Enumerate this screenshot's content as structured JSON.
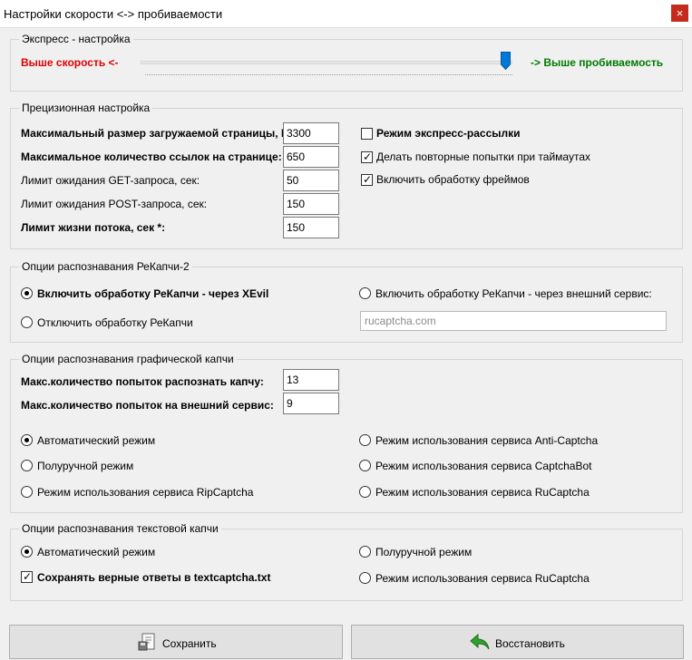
{
  "window": {
    "title": "Настройки скорости <-> пробиваемости",
    "close_glyph": "×"
  },
  "express": {
    "legend": "Экспресс - настройка",
    "left_label": "Выше скорость <-",
    "right_label": "-> Выше пробиваемость",
    "left_color": "#e00000",
    "right_color": "#007a00",
    "slider_level": 0.98
  },
  "precision": {
    "legend": "Прецизионная настройка",
    "fields": [
      {
        "label": "Максимальный размер загружаемой страницы, Кб:",
        "value": "3300"
      },
      {
        "label": "Максимальное количество ссылок на странице:",
        "value": "650"
      },
      {
        "label": "Лимит ожидания GET-запроса, сек:",
        "value": "50"
      },
      {
        "label": "Лимит ожидания POST-запроса, сек:",
        "value": "150"
      },
      {
        "label": "Лимит жизни потока, сек *:",
        "value": "150"
      }
    ],
    "checks": [
      {
        "label": "Режим экспресс-рассылки",
        "checked": false
      },
      {
        "label": "Делать повторные попытки при таймаутах",
        "checked": true
      },
      {
        "label": "Включить обработку фреймов",
        "checked": true
      }
    ]
  },
  "recaptcha": {
    "legend": "Опции распознавания РеКапчи-2",
    "xevil": "Включить обработку РеКапчи - через XEvil",
    "external": "Включить обработку РеКапчи - через внешний сервис:",
    "disable": "Отключить обработку РеКапчи",
    "service_value": "rucaptcha.com"
  },
  "graphic": {
    "legend": "Опции распознавания графической капчи",
    "fields": [
      {
        "label": "Макс.количество попыток распознать капчу:",
        "value": "13"
      },
      {
        "label": "Макс.количество попыток на внешний сервис:",
        "value": "9"
      }
    ],
    "modes_left": [
      "Автоматический режим",
      "Полуручной режим",
      "Режим использования сервиса RipCaptcha"
    ],
    "modes_right": [
      "Режим использования сервиса Anti-Captcha",
      "Режим использования сервиса CaptchaBot",
      "Режим использования сервиса RuCaptcha"
    ]
  },
  "text": {
    "legend": "Опции распознавания текстовой капчи",
    "auto": "Автоматический режим",
    "semi": "Полуручной режим",
    "rucaptcha": "Режим использования сервиса RuCaptcha",
    "save": "Сохранять верные ответы в textcaptcha.txt"
  },
  "buttons": {
    "save": "Сохранить",
    "restore": "Восстановить"
  }
}
